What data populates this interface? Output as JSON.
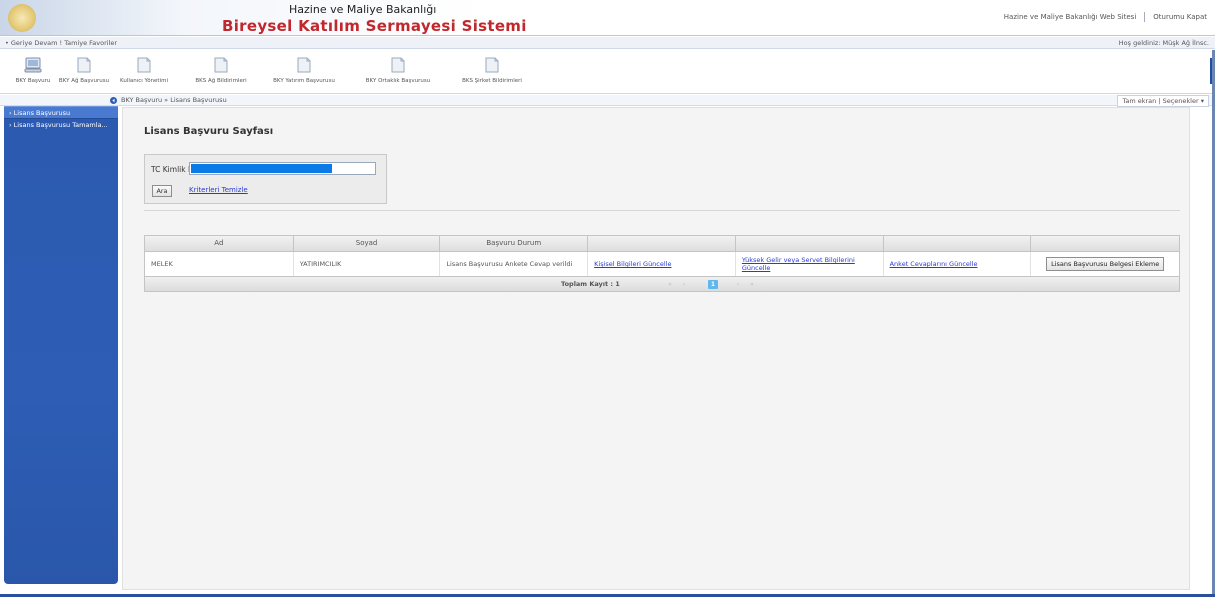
{
  "header": {
    "ministry": "Hazine ve Maliye Bakanlığı",
    "system_title": "Bireysel Katılım Sermayesi Sistemi",
    "user_link": "Hazine ve Maliye Bakanlığı Web Sitesi",
    "logout": "Oturumu Kapat"
  },
  "crumbbar": {
    "left": "• Geriye  Devam !  Tamiye  Favoriler",
    "right": "Hoş geldiniz: Müşk Ağ İlnsc."
  },
  "toolbar": {
    "items": [
      {
        "label": "BKY Başvuru",
        "icon": "computer-icon"
      },
      {
        "label": "BKY Ağ Başvurusu",
        "icon": "folder-icon"
      },
      {
        "label": "Kullanıcı Yönetimi",
        "icon": "folder-icon"
      },
      {
        "label": "BKS Ağ Bildirimleri",
        "icon": "folder-icon"
      },
      {
        "label": "BKY Yatırım Başvurusu",
        "icon": "folder-icon"
      },
      {
        "label": "BKY Ortaklık Başvurusu",
        "icon": "folder-icon"
      },
      {
        "label": "BKS Şirket Bildirimleri",
        "icon": "folder-icon"
      }
    ]
  },
  "navstrip": {
    "path": "BKY Başvuru  »  Lisans Başvurusu",
    "buttons": "Tam ekran | Seçenekler ▾"
  },
  "sidebar": {
    "items": [
      {
        "label": "Lisans Başvurusu"
      },
      {
        "label": "Lisans Başvurusu Tamamla..."
      }
    ]
  },
  "page": {
    "title": "Lisans Başvuru Sayfası",
    "search": {
      "label": "TC Kimlik No",
      "button": "Ara",
      "clear_link": "Kriterleri Temizle"
    }
  },
  "grid": {
    "columns": [
      "Ad",
      "Soyad",
      "Başvuru Durum",
      "",
      "",
      "",
      ""
    ],
    "rows": [
      {
        "ad": "MELEK",
        "soyad": "YATIRIMCILIK",
        "durum": "Lisans Başvurusu Ankete Cevap verildi",
        "link1": "Kişisel Bilgileri Güncelle",
        "link2": "Yüksek Gelir veya Servet Bilgilerini Güncelle",
        "link3": "Anket Cevaplarını Güncelle",
        "button": "Lisans Başvurusu Belgesi Ekleme"
      }
    ],
    "total_label": "Toplam Kayıt : 1",
    "current_page": "1",
    "pager": {
      "first": "«",
      "prev": "‹",
      "next": "›",
      "last": "»"
    }
  },
  "colors": {
    "accent": "#2d5db5",
    "title_red": "#c0282d",
    "link": "#2a3bd0"
  }
}
